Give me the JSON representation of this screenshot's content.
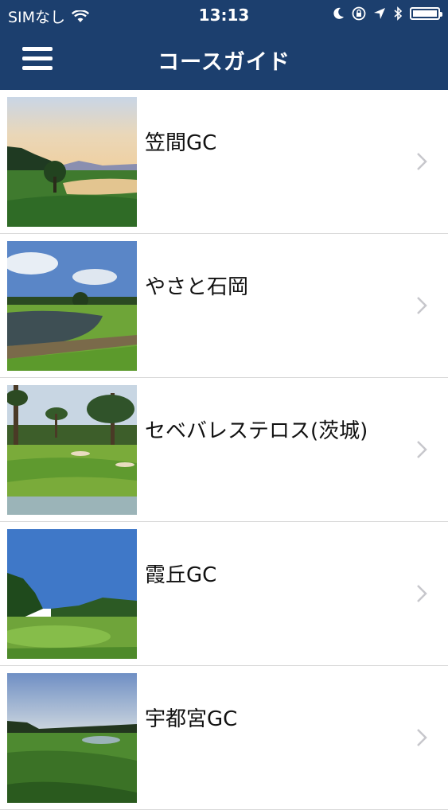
{
  "status_bar": {
    "carrier": "SIMなし",
    "time": "13:13"
  },
  "nav": {
    "title": "コースガイド"
  },
  "courses": [
    {
      "name": "笠間GC"
    },
    {
      "name": "やさと石岡"
    },
    {
      "name": "セベバレステロス(茨城)"
    },
    {
      "name": "霞丘GC"
    },
    {
      "name": "宇都宮GC"
    }
  ],
  "colors": {
    "header_bg": "#1c3f6e",
    "divider": "#d9d9d9",
    "chevron": "#c7c7cc"
  },
  "icons": {
    "menu": "hamburger-menu-icon",
    "chevron": "chevron-right-icon",
    "wifi": "wifi-icon",
    "bluetooth": "bluetooth-icon",
    "location": "location-arrow-icon",
    "moon": "moon-icon",
    "lock": "rotation-lock-icon",
    "battery": "battery-icon"
  }
}
